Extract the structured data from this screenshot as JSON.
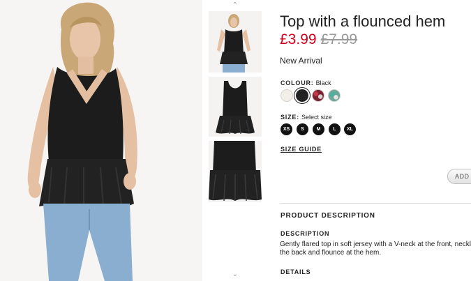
{
  "product": {
    "title": "Top with a flounced hem",
    "price_sale": "£3.99",
    "price_original": "£7.99",
    "badge": "New Arrival"
  },
  "colour": {
    "label": "COLOUR:",
    "selected": "Black",
    "swatches": [
      {
        "name": "off-white",
        "color": "#f2efe8"
      },
      {
        "name": "black",
        "color": "#222222"
      },
      {
        "name": "burgundy pattern",
        "color": "#7a2232"
      },
      {
        "name": "green pattern",
        "color": "#6aa69a"
      }
    ]
  },
  "size": {
    "label": "SIZE:",
    "placeholder": "Select size",
    "options": [
      "XS",
      "S",
      "M",
      "L",
      "XL"
    ]
  },
  "size_guide": "SIZE GUIDE",
  "add_button": "ADD T",
  "description": {
    "section_title": "PRODUCT DESCRIPTION",
    "heading": "DESCRIPTION",
    "text": "Gently flared top in soft jersey with a V-neck at the front, neckline at the back and flounce at the hem.",
    "details_heading": "DETAILS"
  },
  "gallery": {
    "up_arrow": "⌃",
    "down_arrow": "⌄"
  },
  "colors": {
    "sale_price": "#d0021b",
    "old_price": "#9a9a9a"
  }
}
